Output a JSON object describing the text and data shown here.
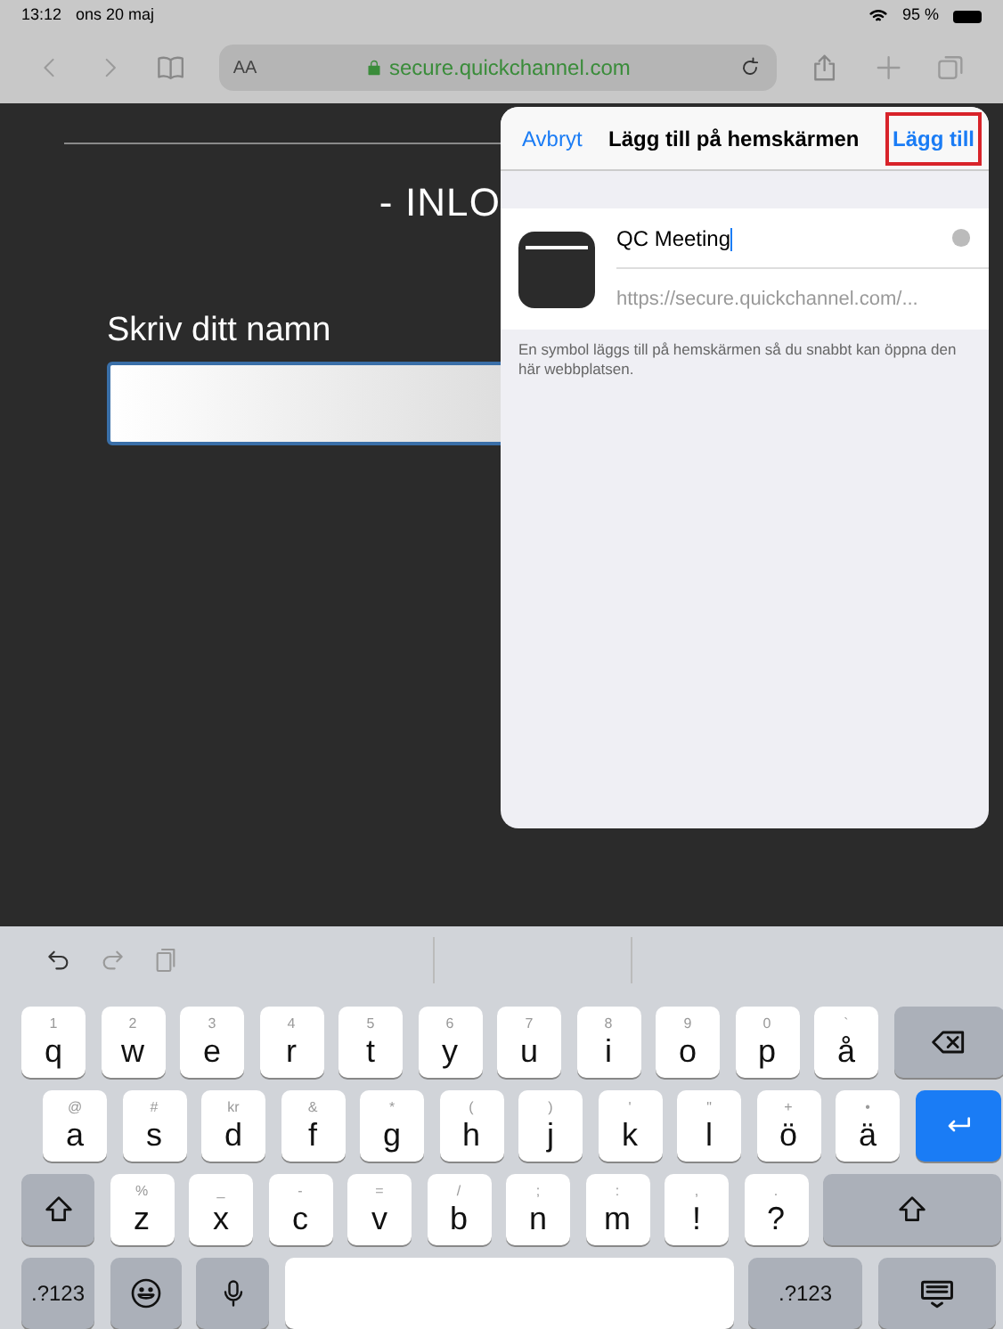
{
  "status_bar": {
    "time": "13:12",
    "date": "ons 20 maj",
    "battery": "95 %"
  },
  "toolbar": {
    "text_size": "AA",
    "url": "secure.quickchannel.com"
  },
  "page": {
    "heading": "- INLO",
    "name_label": "Skriv ditt namn"
  },
  "sheet": {
    "cancel": "Avbryt",
    "title": "Lägg till på hemskärmen",
    "add": "Lägg till",
    "name_value": "QC Meeting",
    "url": "https://secure.quickchannel.com/...",
    "note": "En symbol läggs till på hemskärmen så du snabbt kan öppna den här webbplatsen."
  },
  "keyboard": {
    "rows": [
      [
        {
          "kind": "letter",
          "label": "q",
          "hint": "1"
        },
        {
          "kind": "letter",
          "label": "w",
          "hint": "2"
        },
        {
          "kind": "letter",
          "label": "e",
          "hint": "3"
        },
        {
          "kind": "letter",
          "label": "r",
          "hint": "4"
        },
        {
          "kind": "letter",
          "label": "t",
          "hint": "5"
        },
        {
          "kind": "letter",
          "label": "y",
          "hint": "6"
        },
        {
          "kind": "letter",
          "label": "u",
          "hint": "7"
        },
        {
          "kind": "letter",
          "label": "i",
          "hint": "8"
        },
        {
          "kind": "letter",
          "label": "o",
          "hint": "9"
        },
        {
          "kind": "letter",
          "label": "p",
          "hint": "0"
        },
        {
          "kind": "letter",
          "label": "å",
          "hint": "`"
        },
        {
          "kind": "backspace"
        }
      ],
      [
        {
          "kind": "letter",
          "label": "a",
          "hint": "@"
        },
        {
          "kind": "letter",
          "label": "s",
          "hint": "#"
        },
        {
          "kind": "letter",
          "label": "d",
          "hint": "kr"
        },
        {
          "kind": "letter",
          "label": "f",
          "hint": "&"
        },
        {
          "kind": "letter",
          "label": "g",
          "hint": "*"
        },
        {
          "kind": "letter",
          "label": "h",
          "hint": "("
        },
        {
          "kind": "letter",
          "label": "j",
          "hint": ")"
        },
        {
          "kind": "letter",
          "label": "k",
          "hint": "'"
        },
        {
          "kind": "letter",
          "label": "l",
          "hint": "\""
        },
        {
          "kind": "letter",
          "label": "ö",
          "hint": "+"
        },
        {
          "kind": "letter",
          "label": "ä",
          "hint": "•"
        },
        {
          "kind": "return"
        }
      ],
      [
        {
          "kind": "shift"
        },
        {
          "kind": "letter",
          "label": "z",
          "hint": "%"
        },
        {
          "kind": "letter",
          "label": "x",
          "hint": "_"
        },
        {
          "kind": "letter",
          "label": "c",
          "hint": "-"
        },
        {
          "kind": "letter",
          "label": "v",
          "hint": "="
        },
        {
          "kind": "letter",
          "label": "b",
          "hint": "/"
        },
        {
          "kind": "letter",
          "label": "n",
          "hint": ";"
        },
        {
          "kind": "letter",
          "label": "m",
          "hint": ":"
        },
        {
          "kind": "letter",
          "label": "!",
          "hint": ","
        },
        {
          "kind": "letter",
          "label": "?",
          "hint": "."
        },
        {
          "kind": "shift_wide"
        }
      ],
      [
        {
          "kind": "mode",
          "label": ".?123"
        },
        {
          "kind": "emoji"
        },
        {
          "kind": "mic"
        },
        {
          "kind": "space"
        },
        {
          "kind": "mode_wide",
          "label": ".?123"
        },
        {
          "kind": "hide"
        }
      ]
    ]
  }
}
